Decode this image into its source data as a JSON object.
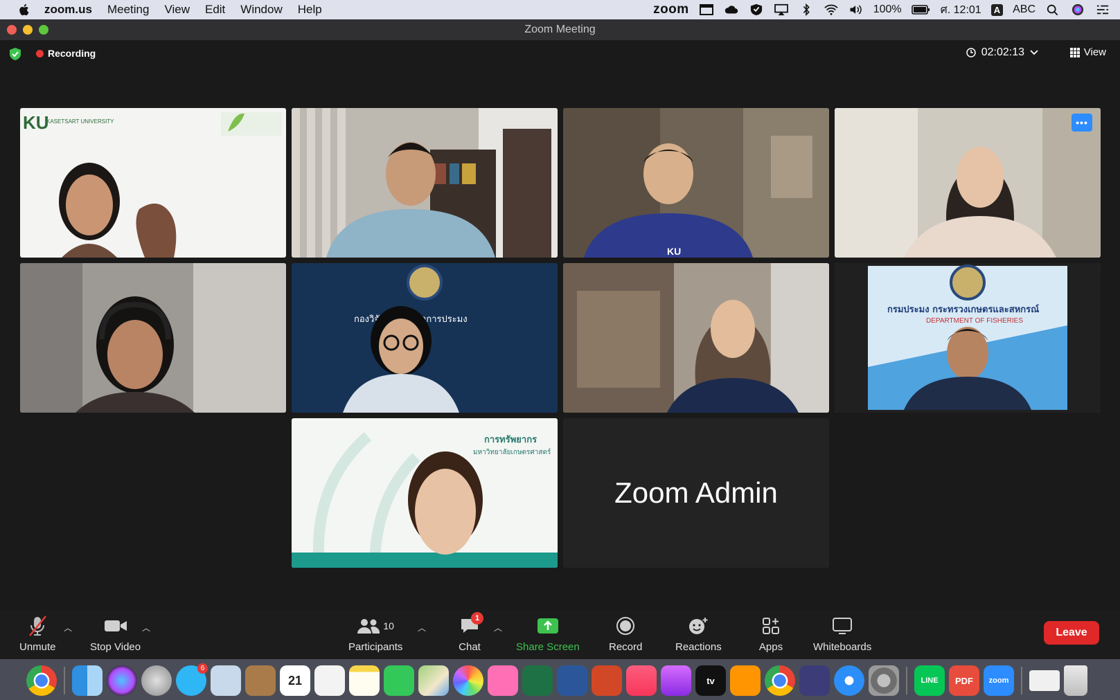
{
  "menubar": {
    "app_name": "zoom.us",
    "menus": [
      "Meeting",
      "View",
      "Edit",
      "Window",
      "Help"
    ],
    "zoom_label": "zoom",
    "battery": "100%",
    "clock": "ศ. 12:01",
    "input_badge": "A",
    "input_source": "ABC"
  },
  "window": {
    "title": "Zoom Meeting"
  },
  "meeting": {
    "recording_label": "Recording",
    "timer": "02:02:13",
    "view_label": "View",
    "tiles": [
      {
        "id": "p1",
        "logo_text": "KU",
        "sub_text": "KASETSART UNIVERSITY"
      },
      {
        "id": "p2"
      },
      {
        "id": "p3",
        "shirt_text": "KU"
      },
      {
        "id": "p4"
      },
      {
        "id": "p5"
      },
      {
        "id": "p6",
        "banner_text": "กองวิจัยและพัฒนาการประมง"
      },
      {
        "id": "p7"
      },
      {
        "id": "p8",
        "banner_text": "กรมประมง  กระทรวงเกษตรและสหกรณ์",
        "banner_sub": "DEPARTMENT OF FISHERIES"
      },
      {
        "id": "p9",
        "banner_text": "การทรัพยากร",
        "banner_sub": "มหาวิทยาลัยเกษตรศาสตร์"
      },
      {
        "id": "p10",
        "name": "Zoom Admin"
      }
    ]
  },
  "toolbar": {
    "unmute": "Unmute",
    "stop_video": "Stop Video",
    "participants": "Participants",
    "participants_count": "10",
    "chat": "Chat",
    "chat_badge": "1",
    "share_screen": "Share Screen",
    "record": "Record",
    "reactions": "Reactions",
    "apps": "Apps",
    "whiteboards": "Whiteboards",
    "leave": "Leave"
  },
  "dock": {
    "messages_badge": "6",
    "calendar_day": "21",
    "tv_label": "tv",
    "line_label": "LINE",
    "pdf_label": "PDF",
    "zoom_label": "zoom"
  },
  "colors": {
    "accent": "#2d8cff",
    "active_speaker": "#3ec24f",
    "leave": "#e02828",
    "recording": "#e53935"
  }
}
